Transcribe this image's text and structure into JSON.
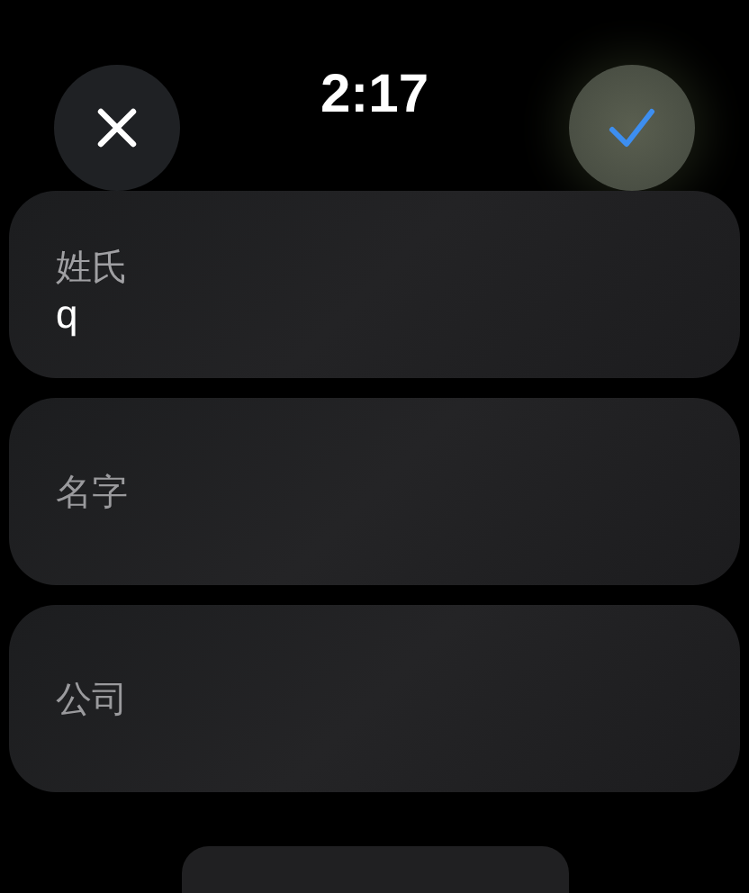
{
  "status_bar": {
    "time": "2:17"
  },
  "fields": [
    {
      "label": "姓氏",
      "value": "q"
    },
    {
      "placeholder": "名字"
    },
    {
      "placeholder": "公司"
    }
  ]
}
